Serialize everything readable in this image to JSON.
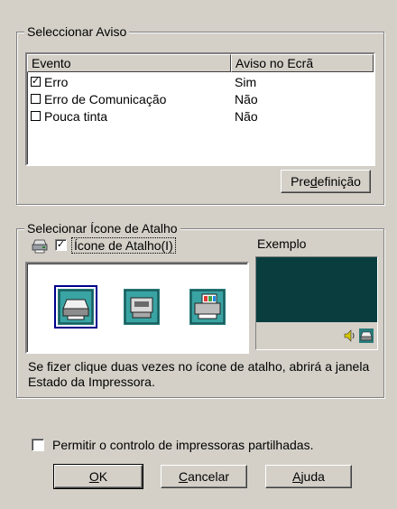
{
  "notice_group": {
    "title": "Seleccionar Aviso",
    "columns": [
      "Evento",
      "Aviso no Ecrã"
    ],
    "rows": [
      {
        "event": "Erro",
        "notice": "Sim",
        "checked": true
      },
      {
        "event": "Erro de Comunicação",
        "notice": "Não",
        "checked": false
      },
      {
        "event": "Pouca tinta",
        "notice": "Não",
        "checked": false
      }
    ],
    "default_button": {
      "pre": "Pre",
      "underline": "d",
      "post": "efinição"
    }
  },
  "shortcut_group": {
    "title": "Selecionar Ícone de Atalho",
    "shortcut_checkbox_label": "Ícone de Atalho(I)",
    "shortcut_checked": true,
    "example_label": "Exemplo",
    "description": "Se fizer clique duas vezes no ícone de atalho, abrirá a janela Estado da Impressora.",
    "icons": [
      "printer-icon-1",
      "printer-icon-2",
      "printer-icon-3"
    ],
    "selected_icon": 0,
    "preview_color": "#0a3e3e"
  },
  "shared_printers": {
    "label": "Permitir o controlo de impressoras partilhadas.",
    "checked": false
  },
  "buttons": {
    "ok": {
      "underline": "O",
      "post": "K"
    },
    "cancel": {
      "underline": "C",
      "post": "ancelar"
    },
    "help": {
      "underline": "A",
      "post": "juda"
    }
  }
}
